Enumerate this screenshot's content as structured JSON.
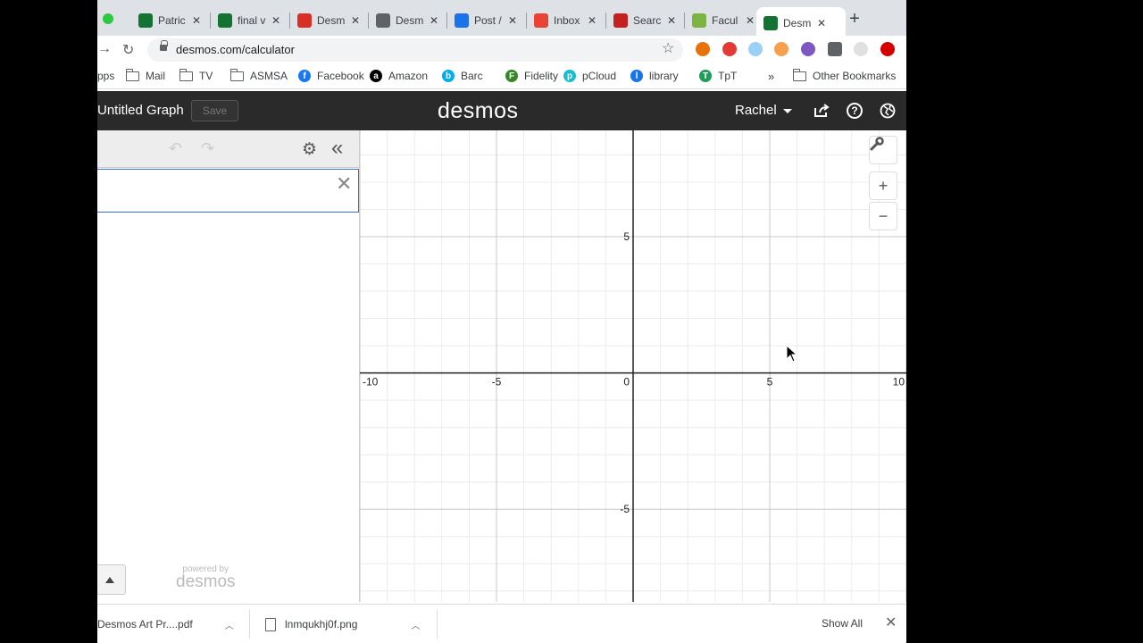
{
  "browser": {
    "tabs": [
      {
        "label": "Patric",
        "color": "#137333"
      },
      {
        "label": "final v",
        "color": "#137333"
      },
      {
        "label": "Desm",
        "color": "#d93025"
      },
      {
        "label": "Desm",
        "color": "#5f6368"
      },
      {
        "label": "Post /",
        "color": "#1a73e8"
      },
      {
        "label": "Inbox",
        "color": "#ea4335"
      },
      {
        "label": "Searc",
        "color": "#c5221f"
      },
      {
        "label": "Facul",
        "color": "#7cb342"
      },
      {
        "label": "Desm",
        "color": "#137333",
        "active": true
      }
    ],
    "url": "desmos.com/calculator",
    "bookmarks": [
      {
        "label": "pps",
        "type": "apps"
      },
      {
        "label": "Mail",
        "type": "folder"
      },
      {
        "label": "TV",
        "type": "folder"
      },
      {
        "label": "ASMSA",
        "type": "folder"
      },
      {
        "label": "Facebook",
        "type": "site",
        "icon": "f",
        "color": "#1877f2"
      },
      {
        "label": "Amazon",
        "type": "site",
        "icon": "a",
        "color": "#000000"
      },
      {
        "label": "Barc",
        "type": "site",
        "icon": "b",
        "color": "#00aeef"
      },
      {
        "label": "Fidelity",
        "type": "site",
        "icon": "F",
        "color": "#368727"
      },
      {
        "label": "pCloud",
        "type": "site",
        "icon": "p",
        "color": "#17bed0"
      },
      {
        "label": "library",
        "type": "site",
        "icon": "l",
        "color": "#1a73e8"
      },
      {
        "label": "TpT",
        "type": "site",
        "icon": "T",
        "color": "#1e9e5a"
      }
    ],
    "more_bookmarks": "»",
    "other_bookmarks": "Other Bookmarks"
  },
  "desmos": {
    "graph_title": "Untitled Graph",
    "save_label": "Save",
    "logo": "desmos",
    "user": "Rachel",
    "powered_by": "powered by",
    "powered_logo": "desmos"
  },
  "graph": {
    "xlim": [
      -10,
      10
    ],
    "ylim": [
      -8.4,
      8.9
    ],
    "x_ticks": [
      -10,
      -5,
      0,
      5,
      10
    ],
    "y_ticks": [
      5,
      -5
    ],
    "x_tick_labels": [
      "-10",
      "-5",
      "0",
      "5",
      "10"
    ],
    "y_tick_labels": [
      "5",
      "-5"
    ],
    "minor_step": 1,
    "major_step": 5
  },
  "downloads": {
    "items": [
      {
        "name": "Desmos Art Pr....pdf"
      },
      {
        "name": "lnmqukhj0f.png"
      }
    ],
    "show_all": "Show All"
  }
}
